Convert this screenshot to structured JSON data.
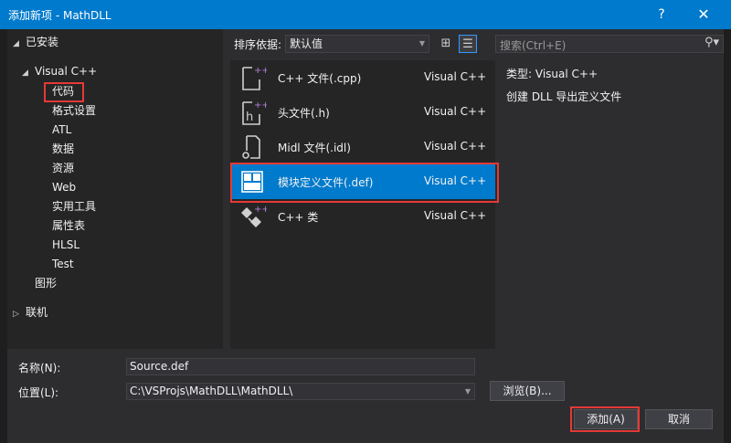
{
  "window": {
    "title": "添加新项 - MathDLL",
    "help_label": "?",
    "close_label": "✕"
  },
  "tree": {
    "installed_label": "已安装",
    "visual_cpp_label": "Visual C++",
    "children": [
      "代码",
      "格式设置",
      "ATL",
      "数据",
      "资源",
      "Web",
      "实用工具",
      "属性表",
      "HLSL",
      "Test"
    ],
    "graphics_label": "图形",
    "online_label": "联机",
    "selected": "代码"
  },
  "toolbar": {
    "sort_label": "排序依据:",
    "sort_value": "默认值"
  },
  "search": {
    "placeholder": "搜索(Ctrl+E)"
  },
  "templates": [
    {
      "name": "C++ 文件(.cpp)",
      "lang": "Visual C++",
      "icon": "cpp-file-icon"
    },
    {
      "name": "头文件(.h)",
      "lang": "Visual C++",
      "icon": "header-file-icon"
    },
    {
      "name": "Midl 文件(.idl)",
      "lang": "Visual C++",
      "icon": "midl-file-icon"
    },
    {
      "name": "模块定义文件(.def)",
      "lang": "Visual C++",
      "icon": "def-file-icon"
    },
    {
      "name": "C++ 类",
      "lang": "Visual C++",
      "icon": "cpp-class-icon"
    }
  ],
  "selected_template_index": 3,
  "info": {
    "type_label": "类型:",
    "type_value": "Visual C++",
    "description": "创建 DLL 导出定义文件"
  },
  "form": {
    "name_label": "名称(N):",
    "name_value": "Source.def",
    "location_label": "位置(L):",
    "location_value": "C:\\VSProjs\\MathDLL\\MathDLL\\",
    "browse_label": "浏览(B)...",
    "add_label": "添加(A)",
    "cancel_label": "取消"
  },
  "colors": {
    "accent": "#007acc",
    "highlight_box": "#e53935",
    "background": "#2d2d30"
  }
}
